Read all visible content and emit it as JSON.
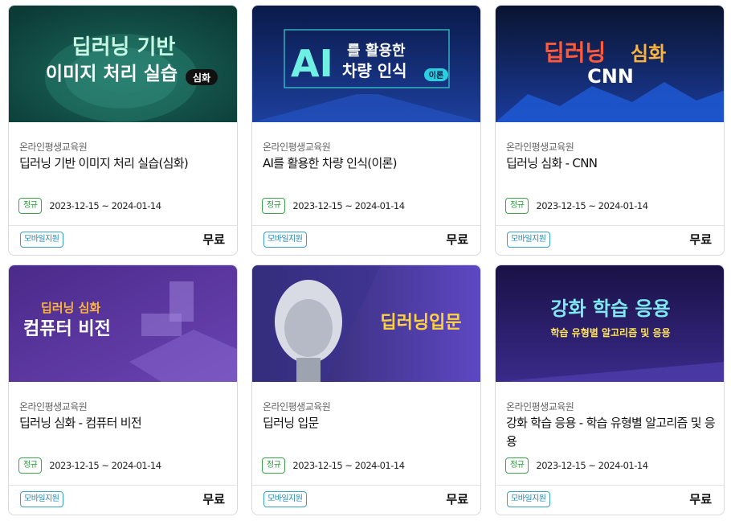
{
  "cards": [
    {
      "provider": "온라인평생교육원",
      "title": "딥러닝 기반 이미지 처리 실습(심화)",
      "badge": "정규",
      "period": "2023-12-15 ~ 2024-01-14",
      "mobile": "모바일지원",
      "price": "무료",
      "thumb_text": [
        "딥러닝 기반",
        "이미지 처리 실습",
        "심화"
      ],
      "thumb_colors": [
        "#0c3b36",
        "#1b6a5e"
      ]
    },
    {
      "provider": "온라인평생교육원",
      "title": "AI를 활용한 차량 인식(이론)",
      "badge": "정규",
      "period": "2023-12-15 ~ 2024-01-14",
      "mobile": "모바일지원",
      "price": "무료",
      "thumb_text": [
        "AI",
        "를 활용한",
        "차량 인식",
        "이론"
      ],
      "thumb_colors": [
        "#0a1a4a",
        "#1d3f9c"
      ]
    },
    {
      "provider": "온라인평생교육원",
      "title": "딥러닝 심화 - CNN",
      "badge": "정규",
      "period": "2023-12-15 ~ 2024-01-14",
      "mobile": "모바일지원",
      "price": "무료",
      "thumb_text": [
        "딥러닝",
        "심화",
        "CNN"
      ],
      "thumb_colors": [
        "#0a1430",
        "#1a3b9a"
      ]
    },
    {
      "provider": "온라인평생교육원",
      "title": "딥러닝 심화 - 컴퓨터 비전",
      "badge": "정규",
      "period": "2023-12-15 ~ 2024-01-14",
      "mobile": "모바일지원",
      "price": "무료",
      "thumb_text": [
        "딥러닝 심화",
        "컴퓨터 비전"
      ],
      "thumb_colors": [
        "#4a2a8a",
        "#6b43b3"
      ]
    },
    {
      "provider": "온라인평생교육원",
      "title": "딥러닝 입문",
      "badge": "정규",
      "period": "2023-12-15 ~ 2024-01-14",
      "mobile": "모바일지원",
      "price": "무료",
      "thumb_text": [
        "딥러닝입문"
      ],
      "thumb_colors": [
        "#2b2560",
        "#5e48c4"
      ]
    },
    {
      "provider": "온라인평생교육원",
      "title": "강화 학습 응용 - 학습 유형별 알고리즘 및 응용",
      "badge": "정규",
      "period": "2023-12-15 ~ 2024-01-14",
      "mobile": "모바일지원",
      "price": "무료",
      "thumb_text": [
        "강화 학습 응용",
        "학습 유형별 알고리즘 및 응용"
      ],
      "thumb_colors": [
        "#1a1146",
        "#3a2a8a"
      ]
    }
  ]
}
